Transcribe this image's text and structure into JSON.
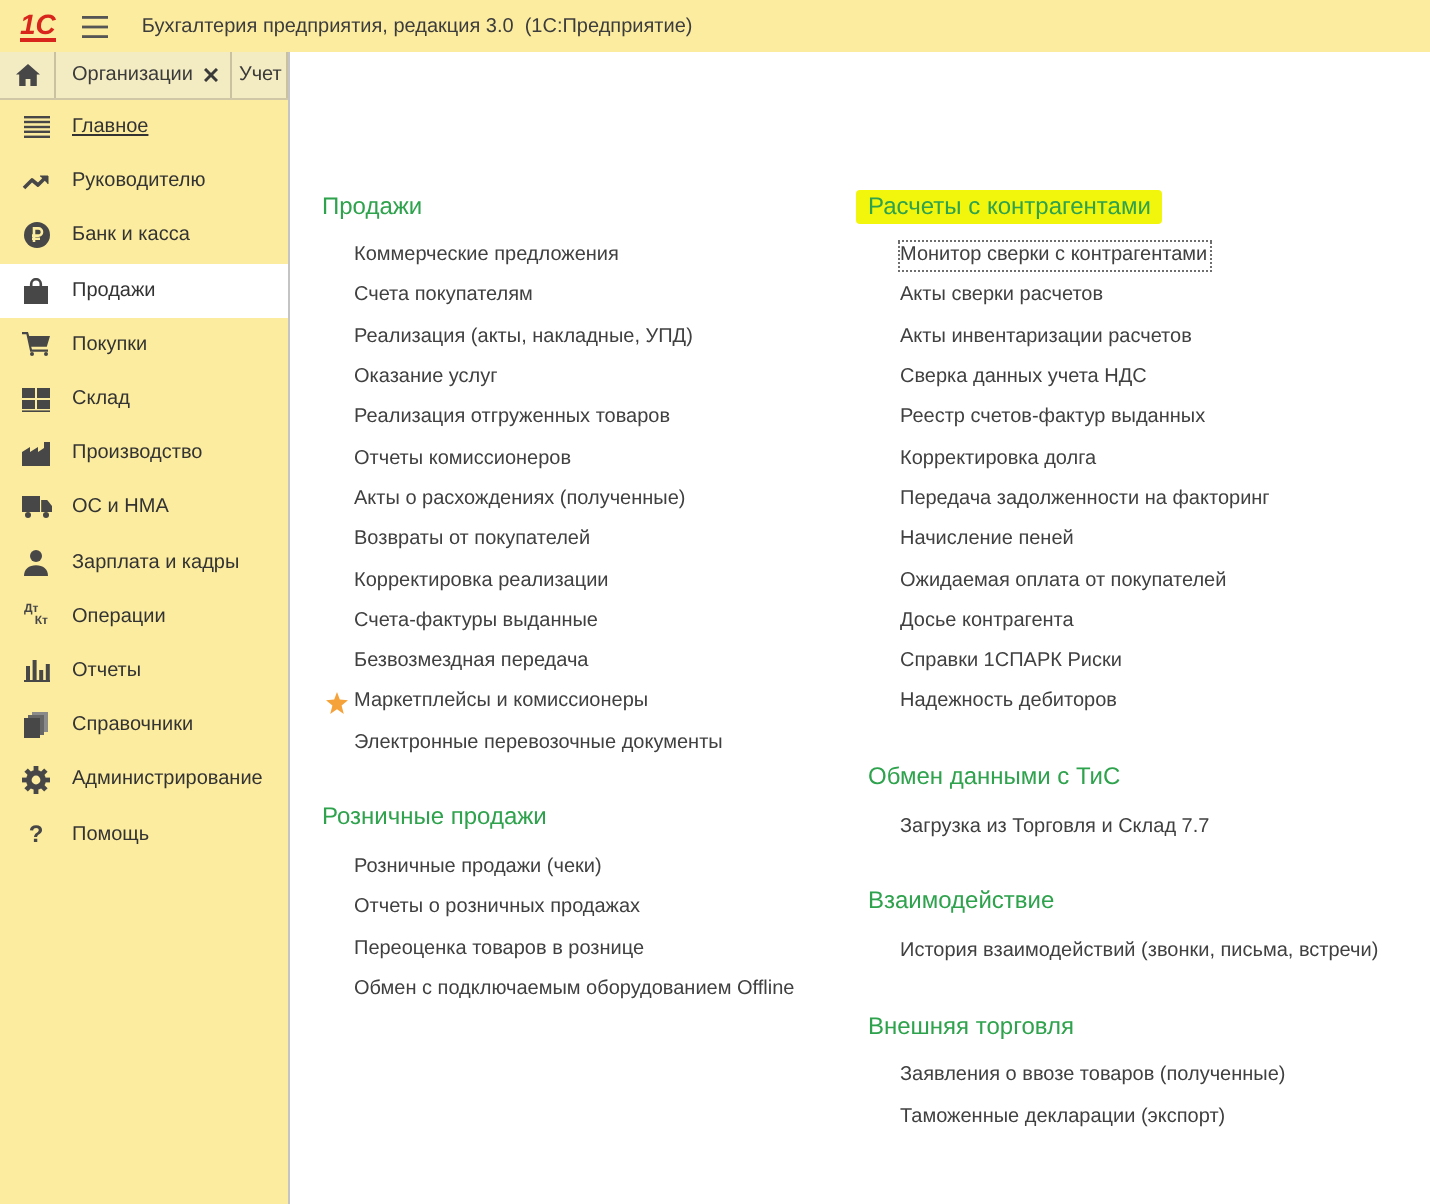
{
  "window": {
    "logo": "1С",
    "title": "Бухгалтерия предприятия, редакция 3.0  (1С:Предприятие)"
  },
  "tabs": [
    {
      "kind": "home",
      "selected": false
    },
    {
      "kind": "page",
      "label": "Организации",
      "closable": true,
      "selected": false
    },
    {
      "kind": "page",
      "label": "Учет",
      "closable": false,
      "selected": false
    }
  ],
  "sidebar": {
    "items": [
      {
        "label": "Главное",
        "selected": false,
        "underlined": true
      },
      {
        "label": "Руководителю",
        "selected": false,
        "underlined": false
      },
      {
        "label": "Банк и касса",
        "selected": false,
        "underlined": false
      },
      {
        "label": "Продажи",
        "selected": true,
        "underlined": false
      },
      {
        "label": "Покупки",
        "selected": false,
        "underlined": false
      },
      {
        "label": "Склад",
        "selected": false,
        "underlined": false
      },
      {
        "label": "Производство",
        "selected": false,
        "underlined": false
      },
      {
        "label": "ОС и НМА",
        "selected": false,
        "underlined": false
      },
      {
        "label": "Зарплата и кадры",
        "selected": false,
        "underlined": false
      },
      {
        "label": "Операции",
        "selected": false,
        "underlined": false,
        "icon_text": [
          "Дт",
          "Кт"
        ]
      },
      {
        "label": "Отчеты",
        "selected": false,
        "underlined": false
      },
      {
        "label": "Справочники",
        "selected": false,
        "underlined": false
      },
      {
        "label": "Администрирование",
        "selected": false,
        "underlined": false
      },
      {
        "label": "Помощь",
        "selected": false,
        "underlined": false,
        "icon_text": [
          "?"
        ]
      }
    ]
  },
  "content": {
    "columns": [
      {
        "sections": [
          {
            "title": "Продажи",
            "highlighted": false,
            "items": [
              {
                "label": "Коммерческие предложения",
                "starred": false,
                "focused": false
              },
              {
                "label": "Счета покупателям",
                "starred": false,
                "focused": false
              },
              {
                "label": "Реализация (акты, накладные, УПД)",
                "starred": false,
                "focused": false
              },
              {
                "label": "Оказание услуг",
                "starred": false,
                "focused": false
              },
              {
                "label": "Реализация отгруженных товаров",
                "starred": false,
                "focused": false
              },
              {
                "label": "Отчеты комиссионеров",
                "starred": false,
                "focused": false
              },
              {
                "label": "Акты о расхождениях (полученные)",
                "starred": false,
                "focused": false
              },
              {
                "label": "Возвраты от покупателей",
                "starred": false,
                "focused": false
              },
              {
                "label": "Корректировка реализации",
                "starred": false,
                "focused": false
              },
              {
                "label": "Счета-фактуры выданные",
                "starred": false,
                "focused": false
              },
              {
                "label": "Безвозмездная передача",
                "starred": false,
                "focused": false
              },
              {
                "label": "Маркетплейсы и комиссионеры",
                "starred": true,
                "focused": false
              },
              {
                "label": "Электронные перевозочные документы",
                "starred": false,
                "focused": false
              }
            ]
          },
          {
            "title": "Розничные продажи",
            "highlighted": false,
            "items": [
              {
                "label": "Розничные продажи (чеки)",
                "starred": false,
                "focused": false
              },
              {
                "label": "Отчеты о розничных продажах",
                "starred": false,
                "focused": false
              },
              {
                "label": "Переоценка товаров в рознице",
                "starred": false,
                "focused": false
              },
              {
                "label": "Обмен с подключаемым оборудованием Offline",
                "starred": false,
                "focused": false
              }
            ]
          }
        ]
      },
      {
        "sections": [
          {
            "title": "Расчеты с контрагентами",
            "highlighted": true,
            "items": [
              {
                "label": "Монитор сверки с контрагентами",
                "starred": false,
                "focused": true
              },
              {
                "label": "Акты сверки расчетов",
                "starred": false,
                "focused": false
              },
              {
                "label": "Акты инвентаризации расчетов",
                "starred": false,
                "focused": false
              },
              {
                "label": "Сверка данных учета НДС",
                "starred": false,
                "focused": false
              },
              {
                "label": "Реестр счетов-фактур выданных",
                "starred": false,
                "focused": false
              },
              {
                "label": "Корректировка долга",
                "starred": false,
                "focused": false
              },
              {
                "label": "Передача задолженности на факторинг",
                "starred": false,
                "focused": false
              },
              {
                "label": "Начисление пеней",
                "starred": false,
                "focused": false
              },
              {
                "label": "Ожидаемая оплата от покупателей",
                "starred": false,
                "focused": false
              },
              {
                "label": "Досье контрагента",
                "starred": false,
                "focused": false
              },
              {
                "label": "Справки 1СПАРК Риски",
                "starred": false,
                "focused": false
              },
              {
                "label": "Надежность дебиторов",
                "starred": false,
                "focused": false
              }
            ]
          },
          {
            "title": "Обмен данными с ТиС",
            "highlighted": false,
            "items": [
              {
                "label": "Загрузка из Торговля и Склад 7.7",
                "starred": false,
                "focused": false
              }
            ]
          },
          {
            "title": "Взаимодействие",
            "highlighted": false,
            "items": [
              {
                "label": "История взаимодействий (звонки, письма, встречи)",
                "starred": false,
                "focused": false
              }
            ]
          },
          {
            "title": "Внешняя торговля",
            "highlighted": false,
            "items": [
              {
                "label": "Заявления о ввозе товаров (полученные)",
                "starred": false,
                "focused": false
              },
              {
                "label": "Таможенные декларации (экспорт)",
                "starred": false,
                "focused": false
              }
            ]
          }
        ]
      }
    ]
  }
}
